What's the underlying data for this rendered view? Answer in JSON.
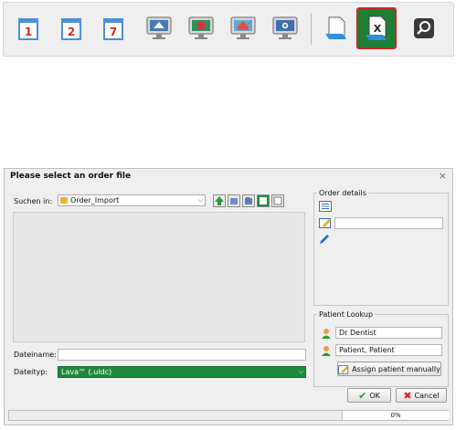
{
  "toolbar": {
    "calendar_buttons": [
      "1",
      "2",
      "7"
    ],
    "icons": [
      "calendar-day-1-icon",
      "calendar-day-2-icon",
      "calendar-week-7-icon",
      "monitor-scan-icon",
      "monitor-design-icon",
      "monitor-home-icon",
      "monitor-settings-icon",
      "open-document-icon",
      "import-excel-document-icon",
      "search-icon"
    ]
  },
  "dialog": {
    "title": "Please select an order file",
    "close": "×",
    "look_in_label": "Suchen in:",
    "look_in_value": "Order_Import",
    "filename_label": "Dateiname:",
    "filename_value": "",
    "filetype_label": "Dateityp:",
    "filetype_value": "Lava™ (.uldc)",
    "order_details_legend": "Order details",
    "order_details_field": "",
    "patient_lookup_legend": "Patient Lookup",
    "dentist_value": "Dr Dentist",
    "patient_value": "Patient, Patient",
    "assign_button": "Assign patient manually",
    "ok_button": "OK",
    "cancel_button": "Cancel",
    "progress_text": "0%",
    "accent_color": "#1e8a3a"
  }
}
